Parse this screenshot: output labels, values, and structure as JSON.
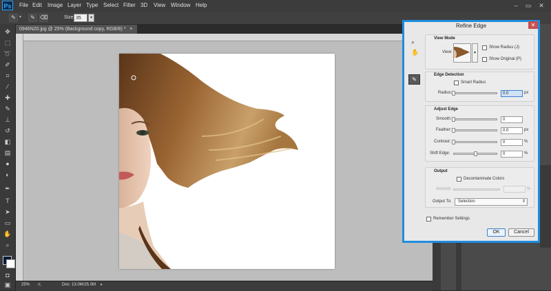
{
  "app": {
    "logo": "Ps"
  },
  "menu": [
    "File",
    "Edit",
    "Image",
    "Layer",
    "Type",
    "Select",
    "Filter",
    "3D",
    "View",
    "Window",
    "Help"
  ],
  "window_controls": {
    "minimize": "–",
    "maximize": "▭",
    "close": "✕"
  },
  "options_bar": {
    "size_label": "Size:",
    "size_value": "35",
    "dropdown_glyph": "▾"
  },
  "document": {
    "tab_title": "0946N20.jpg @ 25% (Background copy, RGB/8) *",
    "close_glyph": "×",
    "zoom": "25%",
    "doc_size": "Doc: 13.0M/25.0M"
  },
  "dialog": {
    "title": "Refine Edge",
    "view_mode": {
      "heading": "View Mode",
      "view_label": "View:",
      "show_radius": "Show Radius (J)",
      "show_original": "Show Original (P)"
    },
    "edge_detection": {
      "heading": "Edge Detection",
      "smart_radius": "Smart Radius",
      "radius_label": "Radius:",
      "radius_value": "0.0",
      "radius_unit": "px",
      "radius_level": 0
    },
    "adjust_edge": {
      "heading": "Adjust Edge",
      "smooth_label": "Smooth:",
      "smooth_value": "0",
      "smooth_level": 0,
      "feather_label": "Feather:",
      "feather_value": "0.0",
      "feather_unit": "px",
      "feather_level": 0,
      "contrast_label": "Contrast:",
      "contrast_value": "0",
      "contrast_unit": "%",
      "contrast_level": 0,
      "shift_label": "Shift Edge:",
      "shift_value": "0",
      "shift_unit": "%",
      "shift_level": 0.5
    },
    "output": {
      "heading": "Output",
      "decontaminate": "Decontaminate Colors",
      "amount_label": "Amount:",
      "amount_unit": "%",
      "output_to_label": "Output To:",
      "output_to_value": "Selection"
    },
    "remember": "Remember Settings",
    "ok": "OK",
    "cancel": "Cancel"
  },
  "colors": {
    "dialog_border": "#1e8ddf",
    "canvas_bg": "#bdbdbd",
    "app_bg": "#2b2b2b"
  }
}
